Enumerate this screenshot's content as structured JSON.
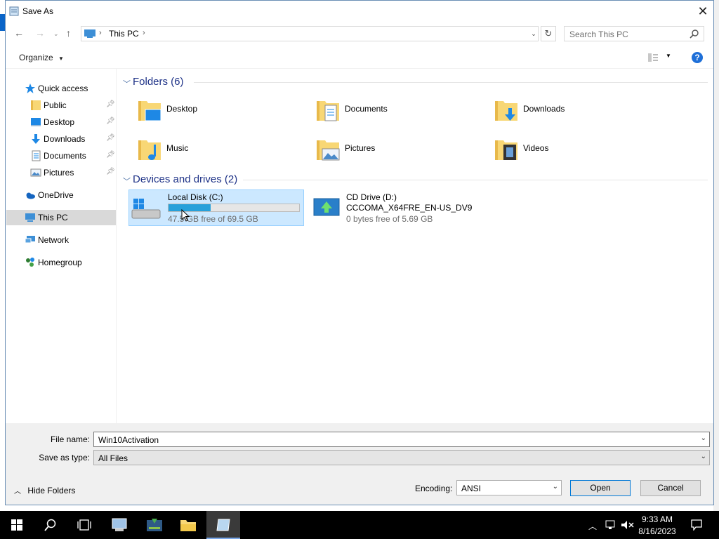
{
  "window": {
    "title": "Save As"
  },
  "address": {
    "path_root": "This PC"
  },
  "search": {
    "placeholder": "Search This PC"
  },
  "toolbar": {
    "organize_label": "Organize",
    "help_label": "?"
  },
  "nav": {
    "items": [
      {
        "label": "Quick access",
        "icon": "star-icon"
      },
      {
        "label": "Public",
        "icon": "folder-icon",
        "pinned": true
      },
      {
        "label": "Desktop",
        "icon": "desktop-icon",
        "pinned": true
      },
      {
        "label": "Downloads",
        "icon": "download-icon",
        "pinned": true
      },
      {
        "label": "Documents",
        "icon": "documents-icon",
        "pinned": true
      },
      {
        "label": "Pictures",
        "icon": "pictures-icon",
        "pinned": true
      },
      {
        "label": "OneDrive",
        "icon": "cloud-icon"
      },
      {
        "label": "This PC",
        "icon": "computer-icon",
        "selected": true
      },
      {
        "label": "Network",
        "icon": "network-icon"
      },
      {
        "label": "Homegroup",
        "icon": "homegroup-icon"
      }
    ]
  },
  "folders": {
    "header": "Folders (6)",
    "items": [
      {
        "label": "Desktop"
      },
      {
        "label": "Documents"
      },
      {
        "label": "Downloads"
      },
      {
        "label": "Music"
      },
      {
        "label": "Pictures"
      },
      {
        "label": "Videos"
      }
    ]
  },
  "drives": {
    "header": "Devices and drives (2)",
    "c": {
      "name": "Local Disk (C:)",
      "free": "47.5 GB free of 69.5 GB",
      "used_fraction": 0.32
    },
    "d": {
      "name": "CD Drive (D:)",
      "volume": "CCCOMA_X64FRE_EN-US_DV9",
      "free": "0 bytes free of 5.69 GB"
    }
  },
  "bottom": {
    "filename_label": "File name:",
    "filename_value": "Win10Activation",
    "savetype_label": "Save as type:",
    "savetype_value": "All Files",
    "hide_folders_label": "Hide Folders",
    "encoding_label": "Encoding:",
    "encoding_value": "ANSI",
    "open_label": "Open",
    "cancel_label": "Cancel"
  },
  "taskbar": {
    "time": "9:33 AM",
    "date": "8/16/2023"
  },
  "colors": {
    "accent": "#0078d7",
    "selection": "#cce8ff",
    "bar_fill": "#26a0da",
    "group_header": "#1e3287"
  }
}
